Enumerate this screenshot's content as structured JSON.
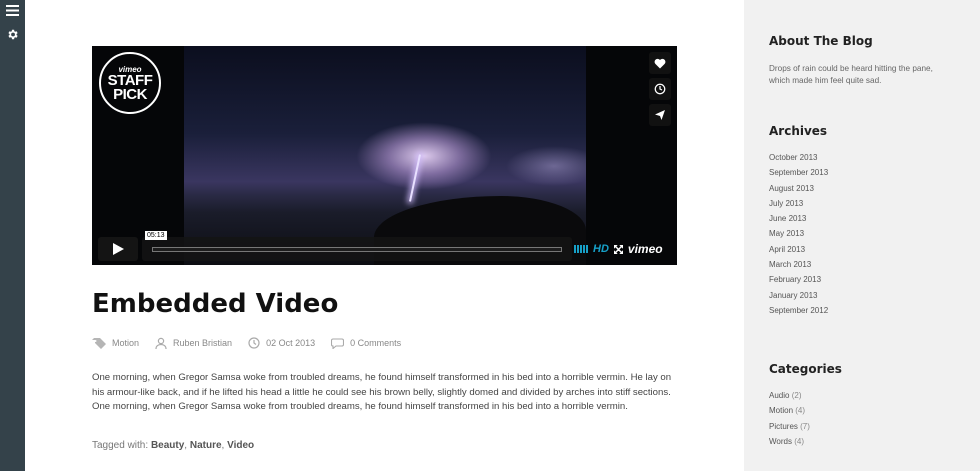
{
  "rail": {
    "icons": [
      "menu-icon",
      "gear-icon"
    ]
  },
  "video": {
    "badge": {
      "top": "vimeo",
      "line1": "STAFF",
      "line2": "PICK"
    },
    "side_buttons": [
      "heart-icon",
      "clock-icon",
      "send-icon"
    ],
    "timecode": "05:13",
    "hd_label": "HD",
    "brand": "vimeo"
  },
  "post": {
    "title": "Embedded Video",
    "meta": {
      "category": "Motion",
      "author": "Ruben Bristian",
      "date": "02 Oct 2013",
      "comments": "0 Comments"
    },
    "body": "One morning, when Gregor Samsa woke from troubled dreams, he found himself transformed in his bed into a horrible vermin. He lay on his armour-like back, and if he lifted his head a little he could see his brown belly, slightly domed and divided by arches into stiff sections. One morning, when Gregor Samsa woke from troubled dreams, he found himself transformed in his bed into a horrible vermin.",
    "tags_label": "Tagged with:",
    "tags": [
      "Beauty",
      "Nature",
      "Video"
    ]
  },
  "sidebar": {
    "about": {
      "title": "About The Blog",
      "text": "Drops of rain could be heard hitting the pane, which made him feel quite sad."
    },
    "archives": {
      "title": "Archives",
      "items": [
        "October 2013",
        "September 2013",
        "August 2013",
        "July 2013",
        "June 2013",
        "May 2013",
        "April 2013",
        "March 2013",
        "February 2013",
        "January 2013",
        "September 2012"
      ]
    },
    "categories": {
      "title": "Categories",
      "items": [
        {
          "name": "Audio",
          "count": "(2)"
        },
        {
          "name": "Motion",
          "count": "(4)"
        },
        {
          "name": "Pictures",
          "count": "(7)"
        },
        {
          "name": "Words",
          "count": "(4)"
        }
      ]
    }
  },
  "colors": {
    "rail": "#34424a",
    "sidebar": "#f1f1f1",
    "vimeo_accent": "#16a0c8"
  }
}
